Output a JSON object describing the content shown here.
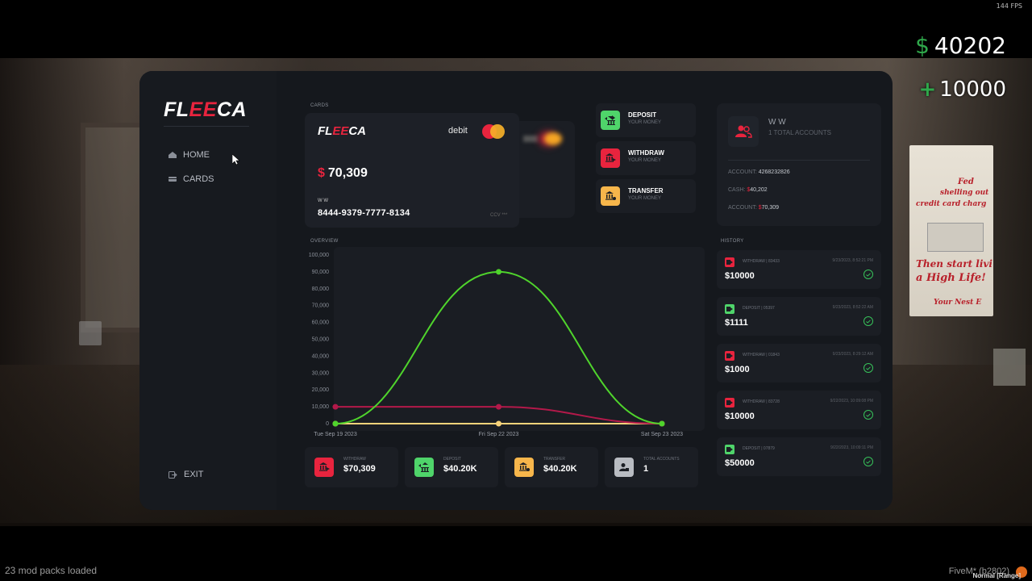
{
  "hud": {
    "fps": "144 FPS",
    "cash_symbol": "$",
    "cash": "40202",
    "bank_plus": "+",
    "bank": "10000",
    "mods_loaded": "23 mod packs loaded",
    "client": "FiveM* (b2802)",
    "voice_mode": "Normal [Range]"
  },
  "background": {
    "poster_lines": [
      "Fed",
      "shelling out",
      "credit card charg",
      "Then start livi",
      "a High Life!",
      "Your Nest E"
    ]
  },
  "sidebar": {
    "logo_white_1": "FL",
    "logo_red": "EE",
    "logo_white_2": "CA",
    "items": [
      {
        "label": "HOME",
        "icon": "home-icon"
      },
      {
        "label": "CARDS",
        "icon": "card-icon"
      }
    ],
    "exit_label": "EXIT"
  },
  "cards": {
    "section_label": "CARDS",
    "logo_white_1": "FL",
    "logo_red": "EE",
    "logo_white_2": "CA",
    "type": "debit",
    "currency": "$",
    "balance": "70,309",
    "holder": "W W",
    "number": "8444-9379-7777-8134",
    "cvv": "CCV ***"
  },
  "actions": [
    {
      "title": "DEPOSIT",
      "subtitle": "YOUR MONEY",
      "color": "#4fd46a",
      "icon": "bank-deposit-icon"
    },
    {
      "title": "WITHDRAW",
      "subtitle": "YOUR MONEY",
      "color": "#e8243e",
      "icon": "bank-withdraw-icon"
    },
    {
      "title": "TRANSFER",
      "subtitle": "YOUR MONEY",
      "color": "#f7b64b",
      "icon": "bank-transfer-icon"
    }
  ],
  "account": {
    "name": "W W",
    "total_accounts": "1 TOTAL ACCOUNTS",
    "account_label": "ACCOUNT:",
    "account_number": "4268232826",
    "cash_label": "CASH:",
    "cash_currency": "$",
    "cash_value": "40,202",
    "account_balance_label": "ACCOUNT:",
    "account_balance_currency": "$",
    "account_balance_value": "70,309"
  },
  "overview": {
    "section_label": "OVERVIEW"
  },
  "chart_data": {
    "type": "line",
    "x": [
      "Tue Sep 19 2023",
      "Fri Sep 22 2023",
      "Sat Sep 23 2023"
    ],
    "ylim": [
      0,
      100000
    ],
    "y_ticks": [
      "100,000",
      "90,000",
      "80,000",
      "70,000",
      "60,000",
      "50,000",
      "40,000",
      "30,000",
      "20,000",
      "10,000",
      "0"
    ],
    "y_tick_values": [
      100000,
      90000,
      80000,
      70000,
      60000,
      50000,
      40000,
      30000,
      20000,
      10000,
      0
    ],
    "series": [
      {
        "color": "#4fd42c",
        "values": [
          0,
          90000,
          0
        ]
      },
      {
        "color": "#b3194a",
        "values": [
          10000,
          10000,
          0
        ]
      },
      {
        "color": "#f7d27a",
        "values": [
          0,
          0,
          0
        ]
      }
    ]
  },
  "stats": [
    {
      "label": "WITHDRAW",
      "value": "$70,309",
      "color": "#e8243e",
      "icon": "bank-withdraw-icon"
    },
    {
      "label": "DEPOSIT",
      "value": "$40.20K",
      "color": "#4fd46a",
      "icon": "bank-deposit-icon"
    },
    {
      "label": "TRANSFER",
      "value": "$40.20K",
      "color": "#f7b64b",
      "icon": "bank-transfer-icon"
    },
    {
      "label": "TOTAL ACCOUNTS",
      "value": "1",
      "color": "#b9bcc2",
      "icon": "accounts-icon"
    }
  ],
  "history": {
    "section_label": "HISTORY",
    "items": [
      {
        "label": "WITHDRAW | 83433",
        "date": "9/23/2023, 8:52:21 PM",
        "amount": "$10000",
        "color": "#e8243e"
      },
      {
        "label": "DEPOSIT | 05397",
        "date": "9/23/2023, 8:52:22 AM",
        "amount": "$1111",
        "color": "#4fd46a"
      },
      {
        "label": "WITHDRAW | 01843",
        "date": "9/23/2023, 8:29:12 AM",
        "amount": "$1000",
        "color": "#e8243e"
      },
      {
        "label": "WITHDRAW | 83728",
        "date": "9/22/2023, 10:09:08 PM",
        "amount": "$10000",
        "color": "#e8243e"
      },
      {
        "label": "DEPOSIT | 07879",
        "date": "9/22/2023, 10:09:11 PM",
        "amount": "$50000",
        "color": "#4fd46a"
      }
    ]
  }
}
